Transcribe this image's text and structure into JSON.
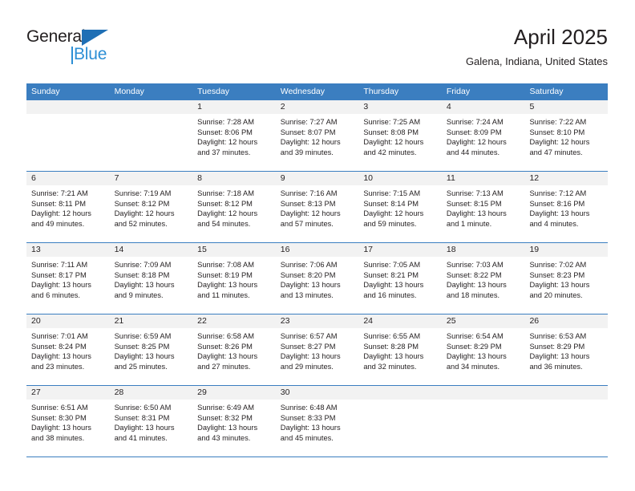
{
  "logo": {
    "word_one": "General",
    "word_two": "Blue",
    "triangle_color": "#1f6fb5",
    "blue_color": "#2d8fd5"
  },
  "header": {
    "title": "April 2025",
    "subtitle": "Galena, Indiana, United States",
    "header_bg_color": "#3b7ec0",
    "date_band_color": "#f2f2f2"
  },
  "weekdays": [
    "Sunday",
    "Monday",
    "Tuesday",
    "Wednesday",
    "Thursday",
    "Friday",
    "Saturday"
  ],
  "weeks": [
    [
      {
        "day": "",
        "sunrise": "",
        "sunset": "",
        "daylight": "",
        "daylight2": ""
      },
      {
        "day": "",
        "sunrise": "",
        "sunset": "",
        "daylight": "",
        "daylight2": ""
      },
      {
        "day": "1",
        "sunrise": "Sunrise: 7:28 AM",
        "sunset": "Sunset: 8:06 PM",
        "daylight": "Daylight: 12 hours",
        "daylight2": "and 37 minutes."
      },
      {
        "day": "2",
        "sunrise": "Sunrise: 7:27 AM",
        "sunset": "Sunset: 8:07 PM",
        "daylight": "Daylight: 12 hours",
        "daylight2": "and 39 minutes."
      },
      {
        "day": "3",
        "sunrise": "Sunrise: 7:25 AM",
        "sunset": "Sunset: 8:08 PM",
        "daylight": "Daylight: 12 hours",
        "daylight2": "and 42 minutes."
      },
      {
        "day": "4",
        "sunrise": "Sunrise: 7:24 AM",
        "sunset": "Sunset: 8:09 PM",
        "daylight": "Daylight: 12 hours",
        "daylight2": "and 44 minutes."
      },
      {
        "day": "5",
        "sunrise": "Sunrise: 7:22 AM",
        "sunset": "Sunset: 8:10 PM",
        "daylight": "Daylight: 12 hours",
        "daylight2": "and 47 minutes."
      }
    ],
    [
      {
        "day": "6",
        "sunrise": "Sunrise: 7:21 AM",
        "sunset": "Sunset: 8:11 PM",
        "daylight": "Daylight: 12 hours",
        "daylight2": "and 49 minutes."
      },
      {
        "day": "7",
        "sunrise": "Sunrise: 7:19 AM",
        "sunset": "Sunset: 8:12 PM",
        "daylight": "Daylight: 12 hours",
        "daylight2": "and 52 minutes."
      },
      {
        "day": "8",
        "sunrise": "Sunrise: 7:18 AM",
        "sunset": "Sunset: 8:12 PM",
        "daylight": "Daylight: 12 hours",
        "daylight2": "and 54 minutes."
      },
      {
        "day": "9",
        "sunrise": "Sunrise: 7:16 AM",
        "sunset": "Sunset: 8:13 PM",
        "daylight": "Daylight: 12 hours",
        "daylight2": "and 57 minutes."
      },
      {
        "day": "10",
        "sunrise": "Sunrise: 7:15 AM",
        "sunset": "Sunset: 8:14 PM",
        "daylight": "Daylight: 12 hours",
        "daylight2": "and 59 minutes."
      },
      {
        "day": "11",
        "sunrise": "Sunrise: 7:13 AM",
        "sunset": "Sunset: 8:15 PM",
        "daylight": "Daylight: 13 hours",
        "daylight2": "and 1 minute."
      },
      {
        "day": "12",
        "sunrise": "Sunrise: 7:12 AM",
        "sunset": "Sunset: 8:16 PM",
        "daylight": "Daylight: 13 hours",
        "daylight2": "and 4 minutes."
      }
    ],
    [
      {
        "day": "13",
        "sunrise": "Sunrise: 7:11 AM",
        "sunset": "Sunset: 8:17 PM",
        "daylight": "Daylight: 13 hours",
        "daylight2": "and 6 minutes."
      },
      {
        "day": "14",
        "sunrise": "Sunrise: 7:09 AM",
        "sunset": "Sunset: 8:18 PM",
        "daylight": "Daylight: 13 hours",
        "daylight2": "and 9 minutes."
      },
      {
        "day": "15",
        "sunrise": "Sunrise: 7:08 AM",
        "sunset": "Sunset: 8:19 PM",
        "daylight": "Daylight: 13 hours",
        "daylight2": "and 11 minutes."
      },
      {
        "day": "16",
        "sunrise": "Sunrise: 7:06 AM",
        "sunset": "Sunset: 8:20 PM",
        "daylight": "Daylight: 13 hours",
        "daylight2": "and 13 minutes."
      },
      {
        "day": "17",
        "sunrise": "Sunrise: 7:05 AM",
        "sunset": "Sunset: 8:21 PM",
        "daylight": "Daylight: 13 hours",
        "daylight2": "and 16 minutes."
      },
      {
        "day": "18",
        "sunrise": "Sunrise: 7:03 AM",
        "sunset": "Sunset: 8:22 PM",
        "daylight": "Daylight: 13 hours",
        "daylight2": "and 18 minutes."
      },
      {
        "day": "19",
        "sunrise": "Sunrise: 7:02 AM",
        "sunset": "Sunset: 8:23 PM",
        "daylight": "Daylight: 13 hours",
        "daylight2": "and 20 minutes."
      }
    ],
    [
      {
        "day": "20",
        "sunrise": "Sunrise: 7:01 AM",
        "sunset": "Sunset: 8:24 PM",
        "daylight": "Daylight: 13 hours",
        "daylight2": "and 23 minutes."
      },
      {
        "day": "21",
        "sunrise": "Sunrise: 6:59 AM",
        "sunset": "Sunset: 8:25 PM",
        "daylight": "Daylight: 13 hours",
        "daylight2": "and 25 minutes."
      },
      {
        "day": "22",
        "sunrise": "Sunrise: 6:58 AM",
        "sunset": "Sunset: 8:26 PM",
        "daylight": "Daylight: 13 hours",
        "daylight2": "and 27 minutes."
      },
      {
        "day": "23",
        "sunrise": "Sunrise: 6:57 AM",
        "sunset": "Sunset: 8:27 PM",
        "daylight": "Daylight: 13 hours",
        "daylight2": "and 29 minutes."
      },
      {
        "day": "24",
        "sunrise": "Sunrise: 6:55 AM",
        "sunset": "Sunset: 8:28 PM",
        "daylight": "Daylight: 13 hours",
        "daylight2": "and 32 minutes."
      },
      {
        "day": "25",
        "sunrise": "Sunrise: 6:54 AM",
        "sunset": "Sunset: 8:29 PM",
        "daylight": "Daylight: 13 hours",
        "daylight2": "and 34 minutes."
      },
      {
        "day": "26",
        "sunrise": "Sunrise: 6:53 AM",
        "sunset": "Sunset: 8:29 PM",
        "daylight": "Daylight: 13 hours",
        "daylight2": "and 36 minutes."
      }
    ],
    [
      {
        "day": "27",
        "sunrise": "Sunrise: 6:51 AM",
        "sunset": "Sunset: 8:30 PM",
        "daylight": "Daylight: 13 hours",
        "daylight2": "and 38 minutes."
      },
      {
        "day": "28",
        "sunrise": "Sunrise: 6:50 AM",
        "sunset": "Sunset: 8:31 PM",
        "daylight": "Daylight: 13 hours",
        "daylight2": "and 41 minutes."
      },
      {
        "day": "29",
        "sunrise": "Sunrise: 6:49 AM",
        "sunset": "Sunset: 8:32 PM",
        "daylight": "Daylight: 13 hours",
        "daylight2": "and 43 minutes."
      },
      {
        "day": "30",
        "sunrise": "Sunrise: 6:48 AM",
        "sunset": "Sunset: 8:33 PM",
        "daylight": "Daylight: 13 hours",
        "daylight2": "and 45 minutes."
      },
      {
        "day": "",
        "sunrise": "",
        "sunset": "",
        "daylight": "",
        "daylight2": ""
      },
      {
        "day": "",
        "sunrise": "",
        "sunset": "",
        "daylight": "",
        "daylight2": ""
      },
      {
        "day": "",
        "sunrise": "",
        "sunset": "",
        "daylight": "",
        "daylight2": ""
      }
    ]
  ]
}
